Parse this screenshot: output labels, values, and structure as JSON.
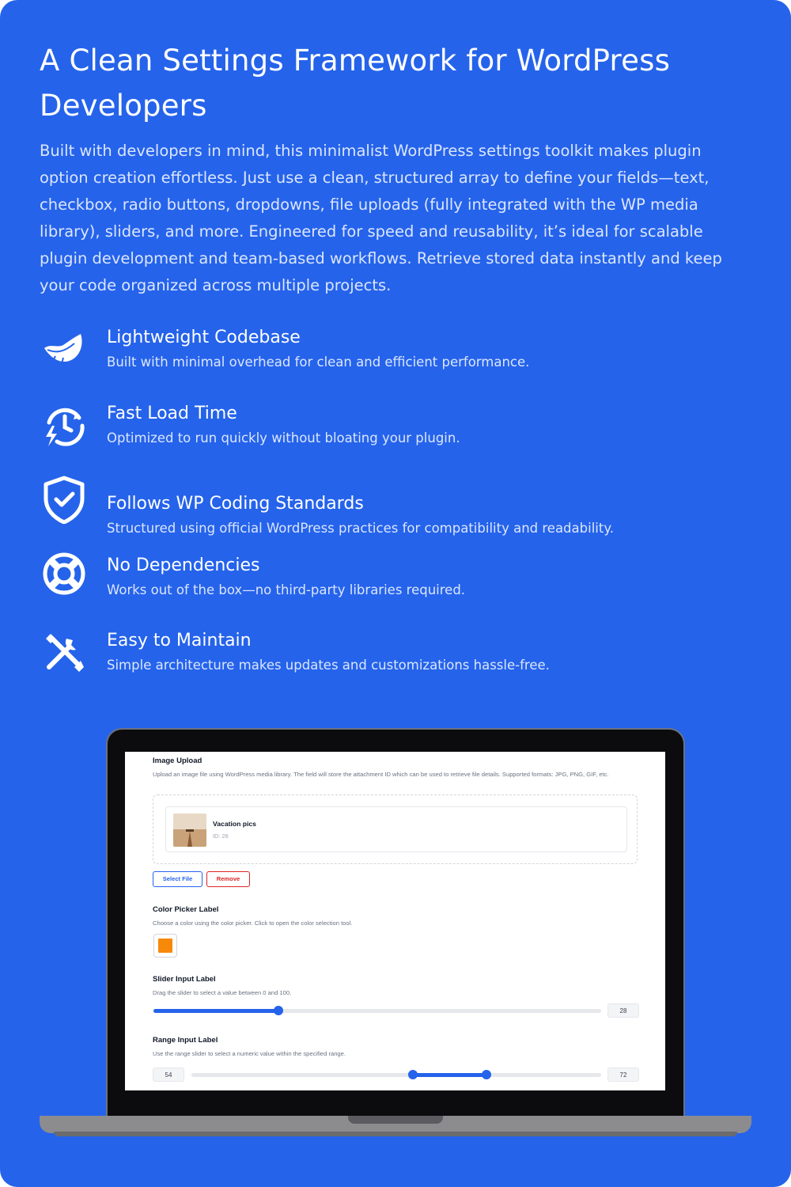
{
  "header": {
    "title": "A Clean Settings Framework for WordPress Developers",
    "description": "Built with developers in mind, this minimalist WordPress settings toolkit makes plugin option creation effortless. Just use a clean, structured array to define your fields—text, checkbox, radio buttons, dropdowns, file uploads (fully integrated with the WP media library), sliders, and more. Engineered for speed and reusability, it’s ideal for scalable plugin development and team-based workflows. Retrieve stored data instantly and keep your code organized across multiple projects."
  },
  "features": [
    {
      "icon": "feather-icon",
      "title": "Lightweight Codebase",
      "text": "Built with minimal overhead for clean and efficient performance."
    },
    {
      "icon": "fast-clock-icon",
      "title": "Fast Load Time",
      "text": "Optimized to run quickly without bloating your plugin."
    },
    {
      "icon": "shield-check-icon",
      "title": "Follows WP Coding Standards",
      "text": "Structured using official WordPress practices for compatibility and readability."
    },
    {
      "icon": "lifebuoy-icon",
      "title": "No Dependencies",
      "text": "Works out of the box—no third-party libraries required."
    },
    {
      "icon": "tools-icon",
      "title": "Easy to Maintain",
      "text": "Simple architecture makes updates and customizations hassle-free."
    }
  ],
  "screen": {
    "image_upload": {
      "label": "Image Upload",
      "help": "Upload an image file using WordPress media library. The field will store the attachment ID which can be used to retrieve file details. Supported formats: JPG, PNG, GIF, etc.",
      "file_name": "Vacation pics",
      "file_id": "ID: 26",
      "select_label": "Select File",
      "remove_label": "Remove"
    },
    "color_picker": {
      "label": "Color Picker Label",
      "help": "Choose a color using the color picker. Click to open the color selection tool.",
      "value": "#f7890a"
    },
    "slider": {
      "label": "Slider Input Label",
      "help": "Drag the slider to select a value between 0 and 100.",
      "value": "28",
      "min": 0,
      "max": 100
    },
    "range": {
      "label": "Range Input Label",
      "help": "Use the range slider to select a numeric value within the specified range.",
      "low": "54",
      "high": "72",
      "min": 0,
      "max": 100
    }
  },
  "colors": {
    "background": "#2563eb",
    "accent": "#2563eb",
    "danger": "#dc2626"
  }
}
